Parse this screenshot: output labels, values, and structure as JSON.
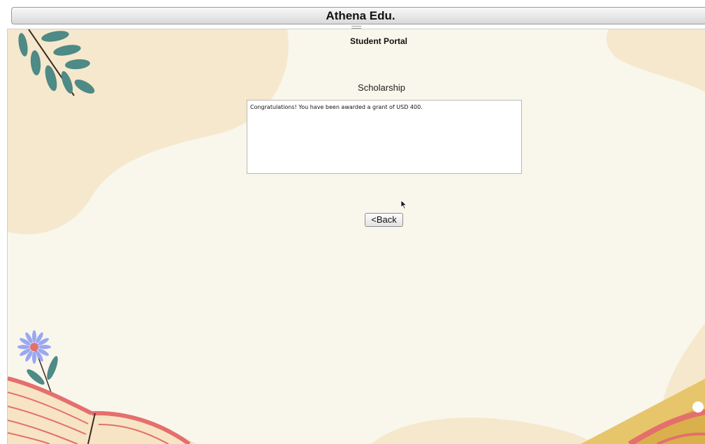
{
  "window": {
    "title": "Athena Edu."
  },
  "header": {
    "portal_title": "Student Portal"
  },
  "main": {
    "section_title": "Scholarship",
    "message": "Congratulations! You have been awarded a grant of USD 400.",
    "back_label": "<Back"
  },
  "icons": {
    "cursor": "mouse-pointer-icon",
    "decor": [
      "leaf-branch-icon",
      "flower-icon",
      "open-book-icon",
      "pencil-icon"
    ]
  },
  "colors": {
    "background": "#f9f6ec",
    "blob": "#f6e8cc",
    "leaf": "#4e8a86",
    "flower": "#9aa8f2",
    "book": "#e46f6c",
    "pencil": "#e7c56a"
  }
}
